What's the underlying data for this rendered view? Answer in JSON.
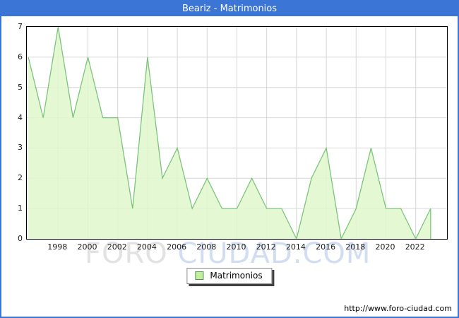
{
  "window": {
    "title": "Beariz - Matrimonios"
  },
  "chart_data": {
    "type": "area",
    "title": "Beariz - Matrimonios",
    "x": [
      1996,
      1997,
      1998,
      1999,
      2000,
      2001,
      2002,
      2003,
      2004,
      2005,
      2006,
      2007,
      2008,
      2009,
      2010,
      2011,
      2012,
      2013,
      2014,
      2015,
      2016,
      2017,
      2018,
      2019,
      2020,
      2021,
      2022,
      2023
    ],
    "series": [
      {
        "name": "Matrimonios",
        "values": [
          6,
          4,
          7,
          4,
          6,
          4,
          4,
          1,
          6,
          2,
          3,
          1,
          2,
          1,
          1,
          2,
          1,
          1,
          0,
          2,
          3,
          0,
          1,
          3,
          1,
          1,
          0,
          1
        ]
      }
    ],
    "xlabel": "",
    "ylabel": "",
    "xlim": [
      1995.9,
      2024.1
    ],
    "ylim": [
      0,
      7
    ],
    "yticks": [
      0,
      1,
      2,
      3,
      4,
      5,
      6,
      7
    ],
    "xticks": [
      1998,
      2000,
      2002,
      2004,
      2006,
      2008,
      2010,
      2012,
      2014,
      2016,
      2018,
      2020,
      2022
    ],
    "grid": true,
    "legend_position": "bottom-center"
  },
  "legend": {
    "label": "Matrimonios"
  },
  "watermark": {
    "part1": "FORO ",
    "part2": "CIUDAD.COM"
  },
  "footer": {
    "url": "http://www.foro-ciudad.com"
  },
  "colors": {
    "accent_blue": "#3b76d6",
    "line_green": "#7cc47c",
    "area_green": "#e0f7cc",
    "legend_swatch": "#c2ef9c",
    "grid_gray": "#d6d6d6",
    "watermark_gray": "#e2e2e2",
    "watermark_blue": "#d2ddf2"
  }
}
